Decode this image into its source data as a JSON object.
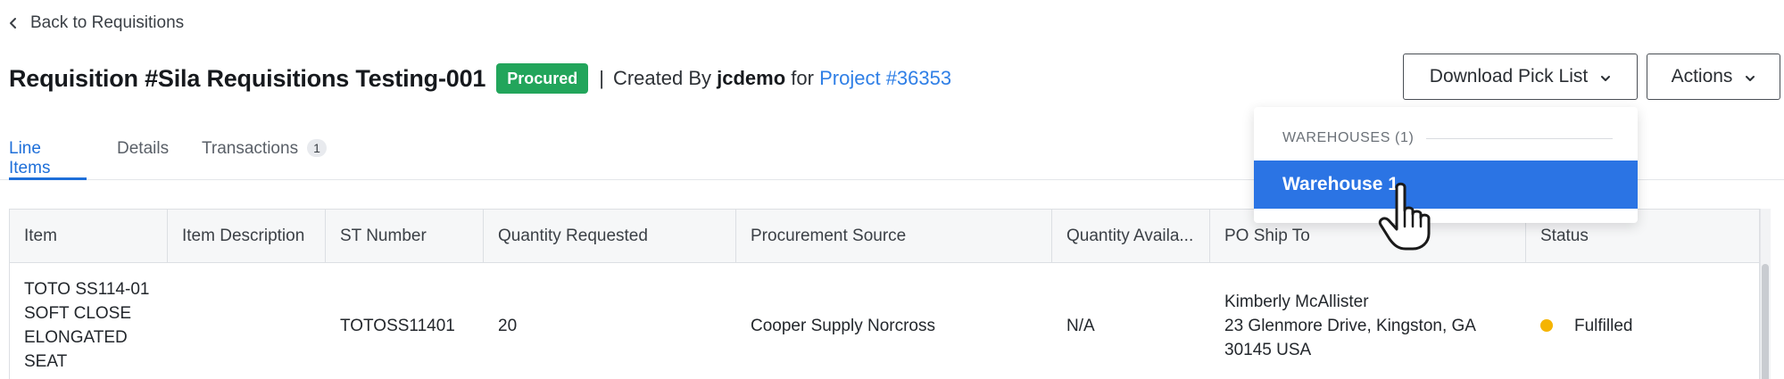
{
  "nav": {
    "back_label": "Back to Requisitions"
  },
  "header": {
    "title": "Requisition #Sila Requisitions Testing-001",
    "status_badge": "Procured",
    "separator": "|",
    "created_by_prefix": "Created By",
    "created_by_user": "jcdemo",
    "for_label": "for",
    "project_link": "Project #36353"
  },
  "buttons": {
    "download_pick_list": "Download Pick List",
    "actions": "Actions"
  },
  "tabs": [
    {
      "label": "Line Items",
      "active": true
    },
    {
      "label": "Details",
      "active": false
    },
    {
      "label": "Transactions",
      "active": false,
      "count": "1"
    }
  ],
  "table": {
    "columns": [
      "Item",
      "Item Description",
      "ST Number",
      "Quantity Requested",
      "Procurement Source",
      "Quantity Availa...",
      "PO Ship To",
      "Status"
    ],
    "rows": [
      {
        "item_lines": [
          "TOTO SS114-01",
          "SOFT CLOSE",
          "ELONGATED",
          "SEAT"
        ],
        "item_description": "",
        "st_number": "TOTOSS11401",
        "quantity_requested": "20",
        "procurement_source": "Cooper Supply Norcross",
        "quantity_available": "N/A",
        "ship_to_lines": [
          "Kimberly McAllister",
          "23 Glenmore Drive, Kingston, GA",
          "30145 USA"
        ],
        "status": "Fulfilled",
        "status_color": "#f5b400"
      }
    ]
  },
  "dropdown": {
    "section_header": "WAREHOUSES (1)",
    "items": [
      "Warehouse 1"
    ]
  },
  "colors": {
    "accent": "#2b74e4",
    "link": "#2f7fe6",
    "procured_badge": "#22a55b",
    "fulfilled_dot": "#f5b400"
  }
}
